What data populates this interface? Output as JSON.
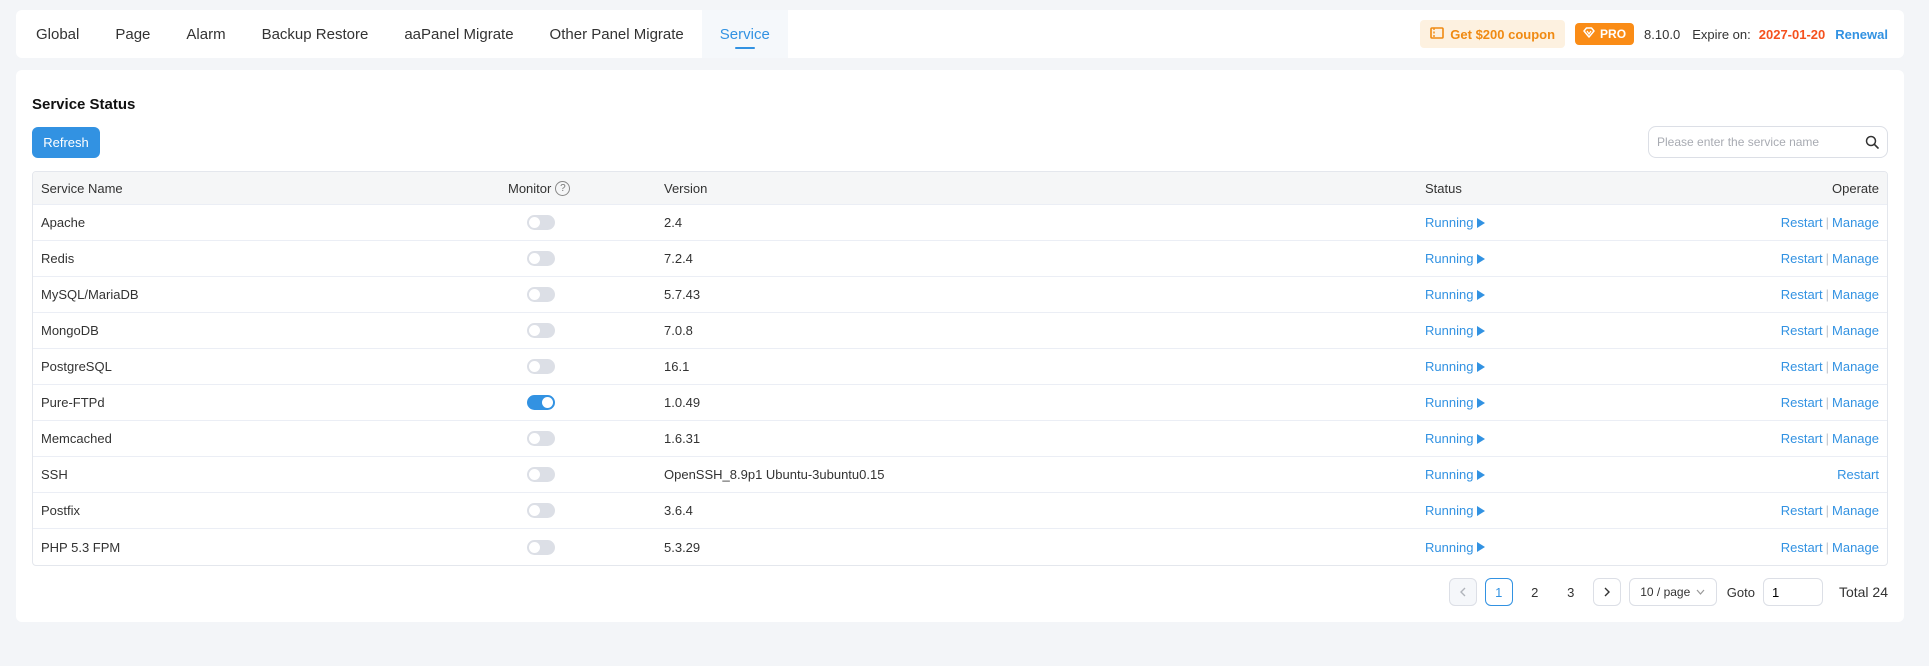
{
  "tabs": [
    {
      "label": "Global",
      "active": false
    },
    {
      "label": "Page",
      "active": false
    },
    {
      "label": "Alarm",
      "active": false
    },
    {
      "label": "Backup Restore",
      "active": false
    },
    {
      "label": "aaPanel Migrate",
      "active": false
    },
    {
      "label": "Other Panel Migrate",
      "active": false
    },
    {
      "label": "Service",
      "active": true
    }
  ],
  "header": {
    "coupon": "Get $200 coupon",
    "pro": "PRO",
    "version": "8.10.0",
    "expire_label": "Expire on:",
    "expire_date": "2027-01-20",
    "renewal": "Renewal"
  },
  "main": {
    "title": "Service Status",
    "refresh_label": "Refresh",
    "search_placeholder": "Please enter the service name"
  },
  "table": {
    "columns": {
      "name": "Service Name",
      "monitor": "Monitor",
      "version": "Version",
      "status": "Status",
      "operate": "Operate"
    },
    "rows": [
      {
        "name": "Apache",
        "monitor": false,
        "version": "2.4",
        "status": "Running",
        "restart": "Restart",
        "manage": "Manage"
      },
      {
        "name": "Redis",
        "monitor": false,
        "version": "7.2.4",
        "status": "Running",
        "restart": "Restart",
        "manage": "Manage"
      },
      {
        "name": "MySQL/MariaDB",
        "monitor": false,
        "version": "5.7.43",
        "status": "Running",
        "restart": "Restart",
        "manage": "Manage"
      },
      {
        "name": "MongoDB",
        "monitor": false,
        "version": "7.0.8",
        "status": "Running",
        "restart": "Restart",
        "manage": "Manage"
      },
      {
        "name": "PostgreSQL",
        "monitor": false,
        "version": "16.1",
        "status": "Running",
        "restart": "Restart",
        "manage": "Manage"
      },
      {
        "name": "Pure-FTPd",
        "monitor": true,
        "version": "1.0.49",
        "status": "Running",
        "restart": "Restart",
        "manage": "Manage"
      },
      {
        "name": "Memcached",
        "monitor": false,
        "version": "1.6.31",
        "status": "Running",
        "restart": "Restart",
        "manage": "Manage"
      },
      {
        "name": "SSH",
        "monitor": false,
        "version": "OpenSSH_8.9p1 Ubuntu-3ubuntu0.15",
        "status": "Running",
        "restart": "Restart",
        "manage": null
      },
      {
        "name": "Postfix",
        "monitor": false,
        "version": "3.6.4",
        "status": "Running",
        "restart": "Restart",
        "manage": "Manage"
      },
      {
        "name": "PHP 5.3 FPM",
        "monitor": false,
        "version": "5.3.29",
        "status": "Running",
        "restart": "Restart",
        "manage": "Manage"
      }
    ]
  },
  "pagination": {
    "pages": [
      "1",
      "2",
      "3"
    ],
    "current": "1",
    "page_size": "10 / page",
    "goto_label": "Goto",
    "goto_value": "1",
    "total": "Total 24"
  },
  "colors": {
    "accent": "#3292e2",
    "pro": "#fa8c16",
    "expire": "#f5511e",
    "coupon_text": "#f08a12"
  }
}
